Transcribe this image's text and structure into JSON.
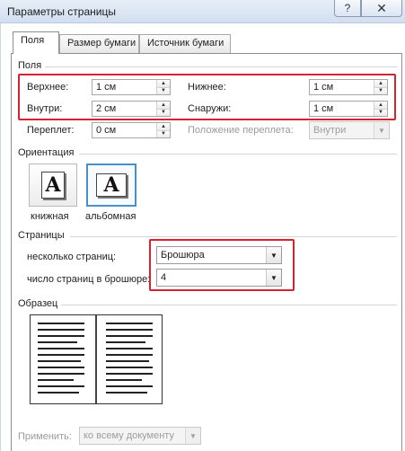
{
  "window": {
    "title": "Параметры страницы",
    "help_glyph": "?",
    "close_glyph": "✕"
  },
  "tabs": [
    {
      "label": "Поля",
      "active": true
    },
    {
      "label": "Размер бумаги",
      "active": false
    },
    {
      "label": "Источник бумаги",
      "active": false
    }
  ],
  "margins": {
    "group_title": "Поля",
    "top_label": "Верхнее:",
    "top_value": "1 см",
    "bottom_label": "Нижнее:",
    "bottom_value": "1 см",
    "inside_label": "Внутри:",
    "inside_value": "2 см",
    "outside_label": "Снаружи:",
    "outside_value": "1 см",
    "gutter_label": "Переплет:",
    "gutter_value": "0 см",
    "gutter_pos_label": "Положение переплета:",
    "gutter_pos_value": "Внутри"
  },
  "orientation": {
    "group_title": "Ориентация",
    "portrait_label": "книжная",
    "landscape_label": "альбомная",
    "icon_glyph": "A",
    "selected": "landscape"
  },
  "pages": {
    "group_title": "Страницы",
    "multiple_label": "несколько страниц:",
    "multiple_value": "Брошюра",
    "sheets_label": "число страниц в брошюре:",
    "sheets_value": "4"
  },
  "preview": {
    "group_title": "Образец"
  },
  "apply": {
    "label": "Применить:",
    "value": "ко всему документу"
  },
  "colors": {
    "highlight": "#d42331",
    "selection_border": "#4a90c8"
  }
}
